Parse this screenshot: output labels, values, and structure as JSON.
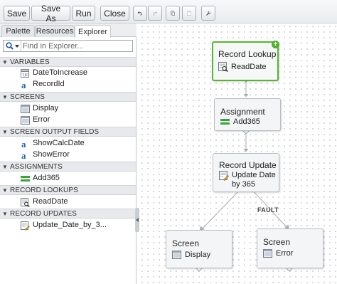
{
  "toolbar": {
    "save_label": "Save",
    "save_as_label": "Save As",
    "run_label": "Run",
    "close_label": "Close",
    "icons": [
      "undo-icon",
      "redo-icon",
      "copy-icon",
      "paste-icon",
      "wrench-icon"
    ]
  },
  "tabs": [
    {
      "label": "Palette",
      "active": false
    },
    {
      "label": "Resources",
      "active": false
    },
    {
      "label": "Explorer",
      "active": true
    }
  ],
  "search": {
    "placeholder": "Find in Explorer..."
  },
  "explorer": {
    "sections": [
      {
        "label": "VARIABLES",
        "items": [
          {
            "label": "DateToIncrease",
            "icon": "date-variable-icon"
          },
          {
            "label": "RecordId",
            "icon": "text-variable-icon"
          }
        ]
      },
      {
        "label": "SCREENS",
        "items": [
          {
            "label": "Display",
            "icon": "screen-icon"
          },
          {
            "label": "Error",
            "icon": "screen-icon"
          }
        ]
      },
      {
        "label": "SCREEN OUTPUT FIELDS",
        "items": [
          {
            "label": "ShowCalcDate",
            "icon": "text-variable-icon"
          },
          {
            "label": "ShowError",
            "icon": "text-variable-icon"
          }
        ]
      },
      {
        "label": "ASSIGNMENTS",
        "items": [
          {
            "label": "Add365",
            "icon": "assignment-icon"
          }
        ]
      },
      {
        "label": "RECORD LOOKUPS",
        "items": [
          {
            "label": "ReadDate",
            "icon": "record-lookup-icon"
          }
        ]
      },
      {
        "label": "RECORD UPDATES",
        "items": [
          {
            "label": "Update_Date_by_3...",
            "icon": "record-update-icon"
          }
        ]
      }
    ]
  },
  "canvas": {
    "nodes": {
      "lookup": {
        "title": "Record Lookup",
        "label": "ReadDate",
        "selected": true
      },
      "assignment": {
        "title": "Assignment",
        "label": "Add365"
      },
      "update": {
        "title": "Record Update",
        "label_line1": "Update Date",
        "label_line2": "by 365"
      },
      "screen_display": {
        "title": "Screen",
        "label": "Display"
      },
      "screen_error": {
        "title": "Screen",
        "label": "Error"
      }
    },
    "fault_label": "FAULT"
  },
  "colors": {
    "selected_border": "#55b62e",
    "add_badge": "#4db32a",
    "assignment_green": "#3aa33a",
    "connector": "#a9aeb4"
  }
}
